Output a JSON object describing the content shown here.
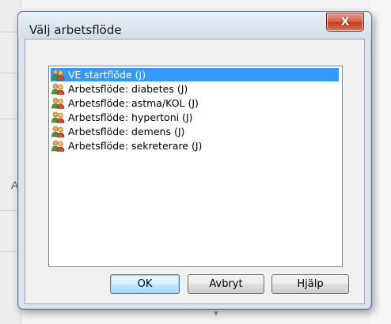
{
  "background": {
    "partial_text": "A"
  },
  "dialog": {
    "title": "Välj arbetsflöde",
    "close_glyph": "X",
    "items": [
      {
        "label": "VE startflöde (J)",
        "selected": true,
        "icon": "users-icon"
      },
      {
        "label": "Arbetsflöde: diabetes (J)",
        "selected": false,
        "icon": "users-icon"
      },
      {
        "label": "Arbetsflöde: astma/KOL (J)",
        "selected": false,
        "icon": "users-icon"
      },
      {
        "label": "Arbetsflöde: hypertoni (J)",
        "selected": false,
        "icon": "users-icon"
      },
      {
        "label": "Arbetsflöde: demens (J)",
        "selected": false,
        "icon": "users-icon"
      },
      {
        "label": "Arbetsflöde: sekreterare (J)",
        "selected": false,
        "icon": "users-icon"
      }
    ],
    "buttons": {
      "ok": "OK",
      "cancel": "Avbryt",
      "help": "Hjälp"
    }
  },
  "colors": {
    "selection": "#3399ff",
    "close_button": "#c43a1e"
  }
}
